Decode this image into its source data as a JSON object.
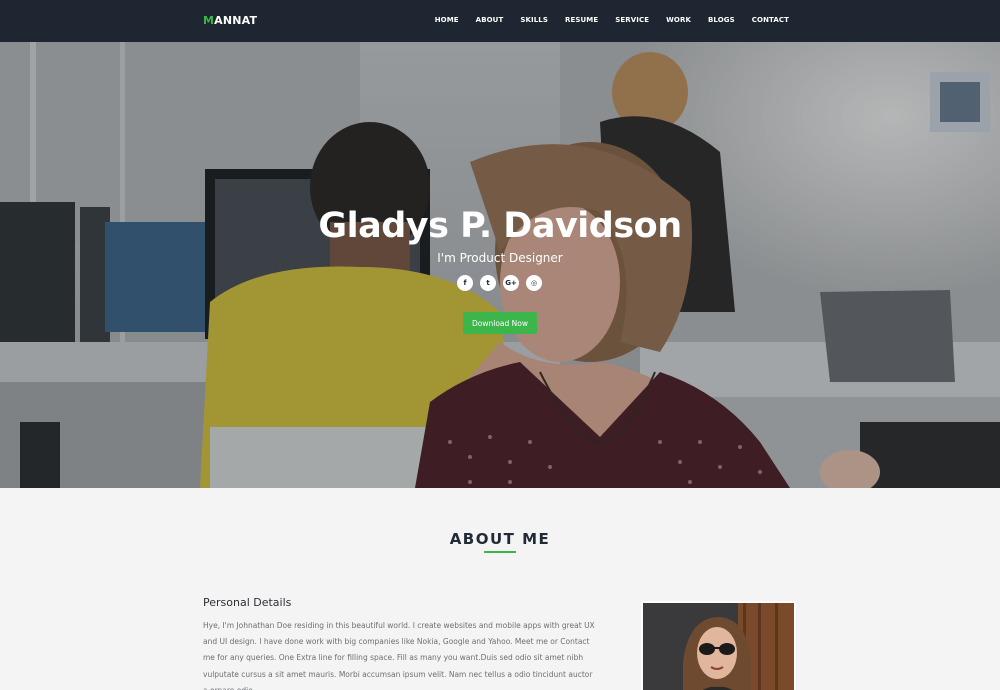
{
  "brand": {
    "accent": "M",
    "rest": "ANNAT"
  },
  "nav": {
    "items": [
      "HOME",
      "ABOUT",
      "SKILLS",
      "RESUME",
      "SERVICE",
      "WORK",
      "BLOGS",
      "CONTACT"
    ]
  },
  "hero": {
    "name": "Gladys P. Davidson",
    "role": "I'm Product Designer",
    "socials": [
      {
        "icon": "facebook-icon",
        "glyph": "f"
      },
      {
        "icon": "twitter-icon",
        "glyph": "t"
      },
      {
        "icon": "google-plus-icon",
        "glyph": "G+"
      },
      {
        "icon": "dribbble-icon",
        "glyph": "◎"
      }
    ],
    "download_label": "Download Now"
  },
  "about": {
    "title": "ABOUT ME",
    "personal_title": "Personal Details",
    "personal_text": "Hye, I'm Johnathan Doe residing in this beautiful world. I create websites and mobile apps with great UX and UI design. I have done work with big companies like Nokia, Google and Yahoo. Meet me or Contact me for any queries. One Extra line for filling space. Fill as many you want.Duis sed odio sit amet nibh vulputate cursus a sit amet mauris. Morbi accumsan ipsum velit. Nam nec tellus a odio tincidunt auctor a ornare odio."
  },
  "colors": {
    "accent": "#3cb54a",
    "navbar": "#1d2631",
    "page_bg": "#f4f4f4"
  }
}
